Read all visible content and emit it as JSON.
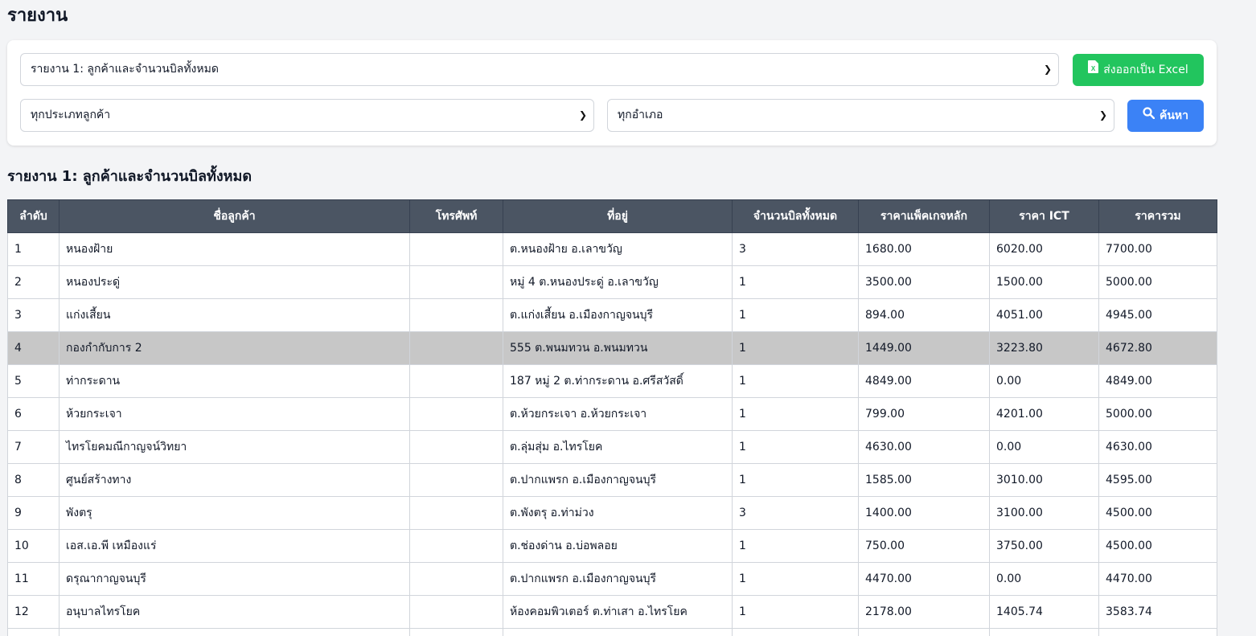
{
  "page": {
    "title": "รายงาน"
  },
  "filters": {
    "report_select": "รายงาน 1: ลูกค้าและจำนวนบิลทั้งหมด",
    "customer_type_select": "ทุกประเภทลูกค้า",
    "district_select": "ทุกอำเภอ",
    "export_label": "ส่งออกเป็น Excel",
    "search_label": "ค้นหา"
  },
  "report": {
    "title": "รายงาน 1: ลูกค้าและจำนวนบิลทั้งหมด",
    "columns": [
      "ลำดับ",
      "ชื่อลูกค้า",
      "โทรศัพท์",
      "ที่อยู่",
      "จำนวนบิลทั้งหมด",
      "ราคาแพ็คเกจหลัก",
      "ราคา ICT",
      "ราคารวม"
    ],
    "rows": [
      [
        "1",
        "หนองฝ้าย",
        "",
        "ต.หนองฝ้าย อ.เลาขวัญ",
        "3",
        "1680.00",
        "6020.00",
        "7700.00"
      ],
      [
        "2",
        "หนองประดู่",
        "",
        "หมู่ 4 ต.หนองประดู่ อ.เลาขวัญ",
        "1",
        "3500.00",
        "1500.00",
        "5000.00"
      ],
      [
        "3",
        "แก่งเสี้ยน",
        "",
        "ต.แก่งเสี้ยน อ.เมืองกาญจนบุรี",
        "1",
        "894.00",
        "4051.00",
        "4945.00"
      ],
      [
        "4",
        "กองกำกับการ 2",
        "",
        "555 ต.พนมทวน อ.พนมทวน",
        "1",
        "1449.00",
        "3223.80",
        "4672.80"
      ],
      [
        "5",
        "ท่ากระดาน",
        "",
        "187 หมู่ 2 ต.ท่ากระดาน อ.ศรีสวัสดิ์",
        "1",
        "4849.00",
        "0.00",
        "4849.00"
      ],
      [
        "6",
        "ห้วยกระเจา",
        "",
        "ต.ห้วยกระเจา อ.ห้วยกระเจา",
        "1",
        "799.00",
        "4201.00",
        "5000.00"
      ],
      [
        "7",
        "ไทรโยคมณีกาญจน์วิทยา",
        "",
        "ต.ลุ่มสุ่ม อ.ไทรโยค",
        "1",
        "4630.00",
        "0.00",
        "4630.00"
      ],
      [
        "8",
        "ศูนย์สร้างทาง",
        "",
        "ต.ปากแพรก อ.เมืองกาญจนบุรี",
        "1",
        "1585.00",
        "3010.00",
        "4595.00"
      ],
      [
        "9",
        "พังตรุ",
        "",
        "ต.พังตรุ อ.ท่าม่วง",
        "3",
        "1400.00",
        "3100.00",
        "4500.00"
      ],
      [
        "10",
        "เอส.เอ.พี เหมืองแร่",
        "",
        "ต.ช่องด่าน อ.บ่อพลอย",
        "1",
        "750.00",
        "3750.00",
        "4500.00"
      ],
      [
        "11",
        "ดรุณากาญจนบุรี",
        "",
        "ต.ปากแพรก อ.เมืองกาญจนบุรี",
        "1",
        "4470.00",
        "0.00",
        "4470.00"
      ],
      [
        "12",
        "อนุบาลไทรโยค",
        "",
        "ห้องคอมพิวเตอร์ ต.ท่าเสา อ.ไทรโยค",
        "1",
        "2178.00",
        "1405.74",
        "3583.74"
      ],
      [
        "",
        "",
        "",
        "",
        "",
        "",
        "",
        ""
      ]
    ],
    "highlighted_row": 3
  },
  "colors": {
    "header_bg": "#4b5563",
    "excel_button": "#22c55e",
    "search_button": "#3b82f6",
    "highlight_row": "#c7c7c7"
  },
  "icons": {
    "export": "excel-file-icon",
    "search": "search-icon",
    "dropdown": "chevron-down-icon"
  }
}
